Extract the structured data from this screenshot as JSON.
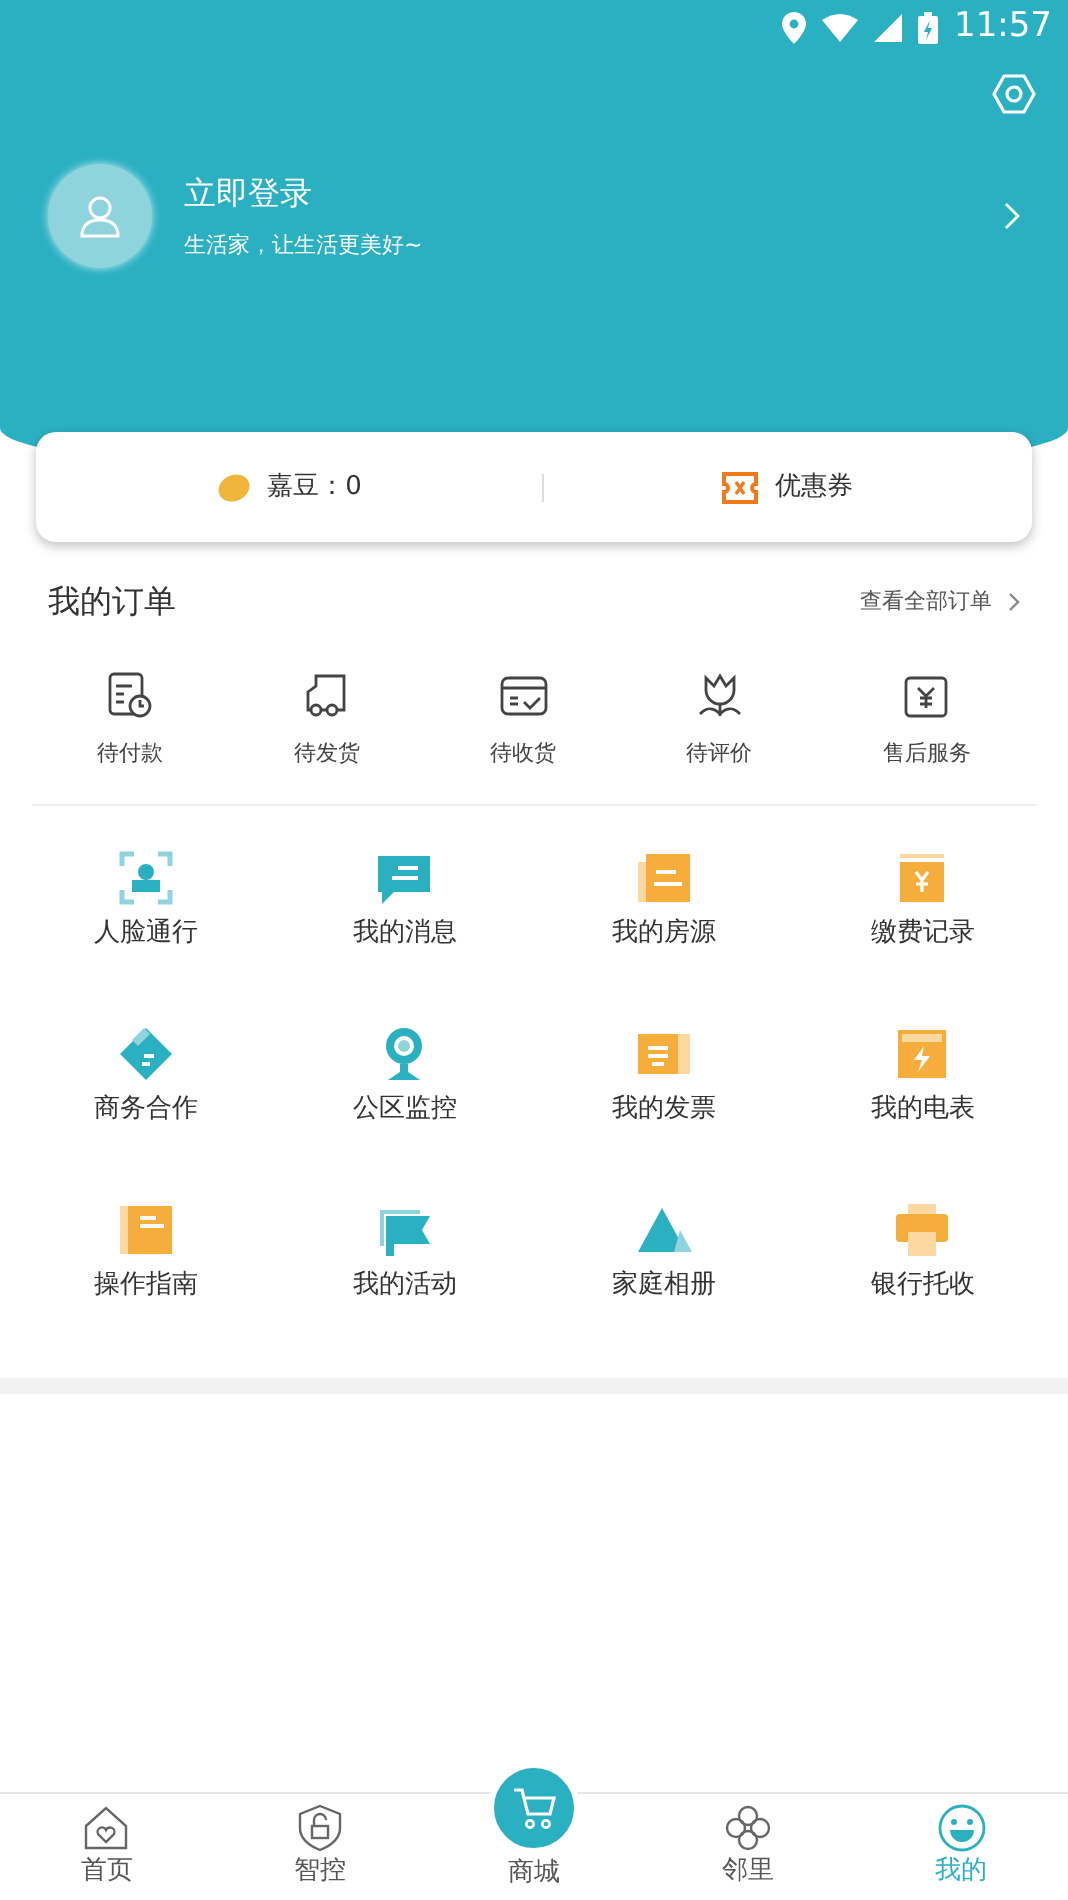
{
  "status_bar": {
    "time": "11:57"
  },
  "profile": {
    "title": "立即登录",
    "subtitle": "生活家，让生活更美好~"
  },
  "wallet": [
    {
      "label": "嘉豆：0"
    },
    {
      "label": "优惠券"
    }
  ],
  "orders": {
    "title": "我的订单",
    "link": "查看全部订单",
    "items": [
      {
        "label": "待付款"
      },
      {
        "label": "待发货"
      },
      {
        "label": "待收货"
      },
      {
        "label": "待评价"
      },
      {
        "label": "售后服务"
      }
    ]
  },
  "services": [
    {
      "label": "人脸通行"
    },
    {
      "label": "我的消息"
    },
    {
      "label": "我的房源"
    },
    {
      "label": "缴费记录"
    },
    {
      "label": "商务合作"
    },
    {
      "label": "公区监控"
    },
    {
      "label": "我的发票"
    },
    {
      "label": "我的电表"
    },
    {
      "label": "操作指南"
    },
    {
      "label": "我的活动"
    },
    {
      "label": "家庭相册"
    },
    {
      "label": "银行托收"
    }
  ],
  "tab_bar": [
    {
      "label": "首页",
      "selected": false,
      "kind": "tab"
    },
    {
      "label": "智控",
      "selected": false,
      "kind": "tab"
    },
    {
      "label": "商城",
      "selected": false,
      "kind": "center"
    },
    {
      "label": "邻里",
      "selected": false,
      "kind": "tab"
    },
    {
      "label": "我的",
      "selected": true,
      "kind": "tab"
    }
  ]
}
